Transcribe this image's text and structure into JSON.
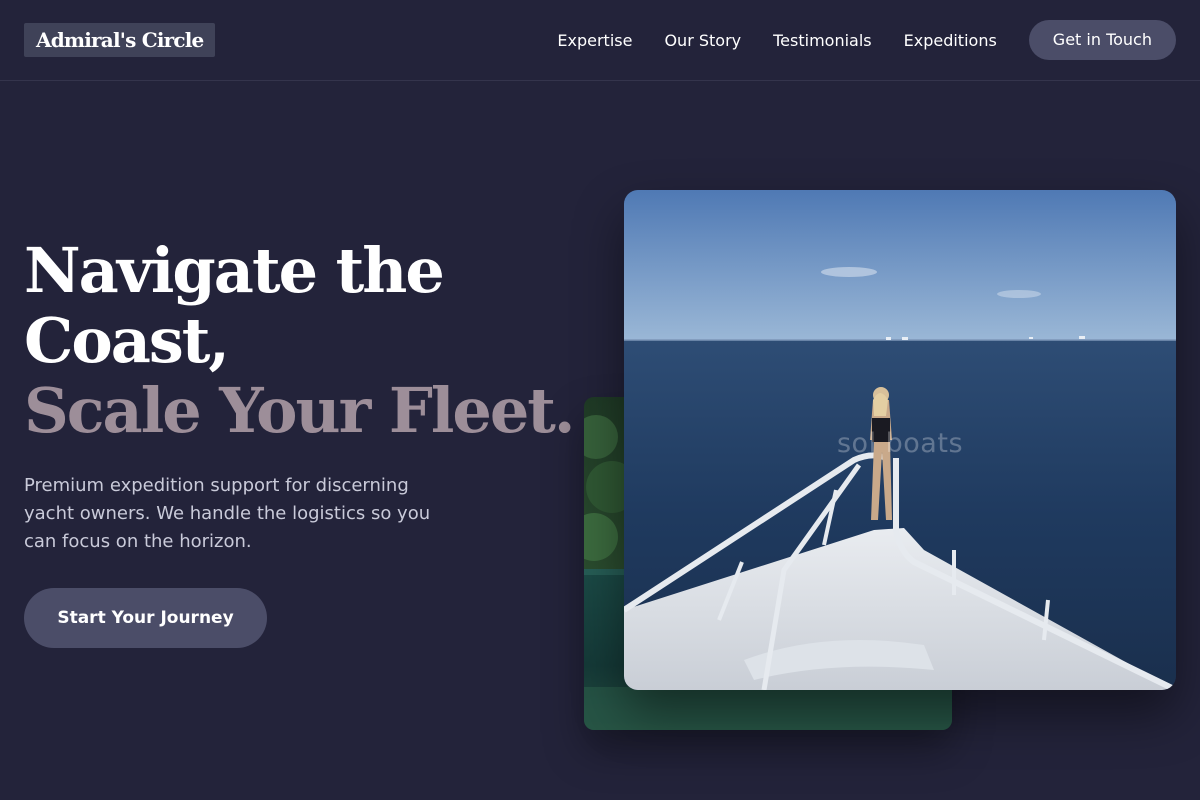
{
  "header": {
    "logo": "Admiral's Circle",
    "nav": [
      "Expertise",
      "Our Story",
      "Testimonials",
      "Expeditions"
    ],
    "cta": "Get in Touch"
  },
  "hero": {
    "title_line1": "Navigate the",
    "title_line2": "Coast,",
    "title_accent": "Scale Your Fleet.",
    "subtitle": "Premium expedition support for discerning yacht owners. We handle the logistics so you can focus on the horizon.",
    "button": "Start Your Journey"
  },
  "images": {
    "main_watermark": "sol  boats"
  },
  "colors": {
    "background": "#23233a",
    "accent_text": "#9d8e99",
    "button": "#4b4d68"
  }
}
